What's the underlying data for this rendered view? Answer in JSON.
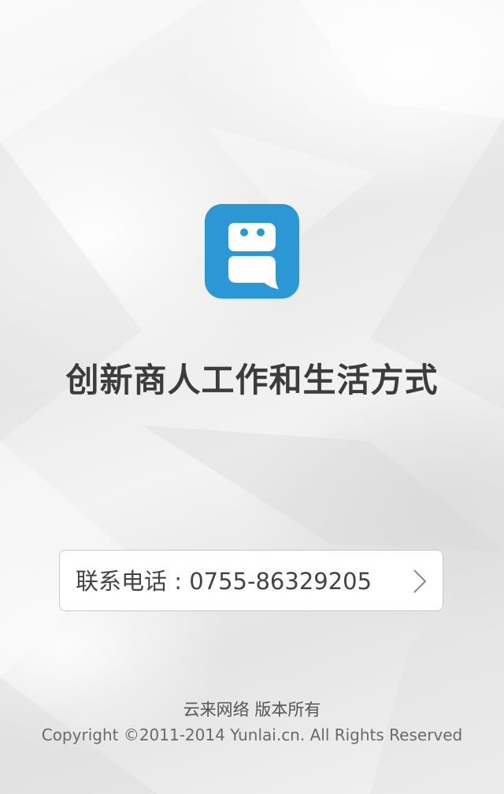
{
  "slogan": "创新商人工作和生活方式",
  "contact": {
    "phone_text": "联系电话 : 0755-86329205"
  },
  "footer": {
    "company": "云来网络  版本所有",
    "copyright": "Copyright ©2011-2014 Yunlai.cn. All Rights Reserved"
  },
  "icons": {
    "app_icon": "robot-chat-bubble-icon",
    "chevron": "chevron-right-icon"
  },
  "colors": {
    "brand_blue": "#2b97d4",
    "slogan_text": "#3c3c3c",
    "phone_text": "#444444",
    "card_border": "#c9c9c9"
  }
}
